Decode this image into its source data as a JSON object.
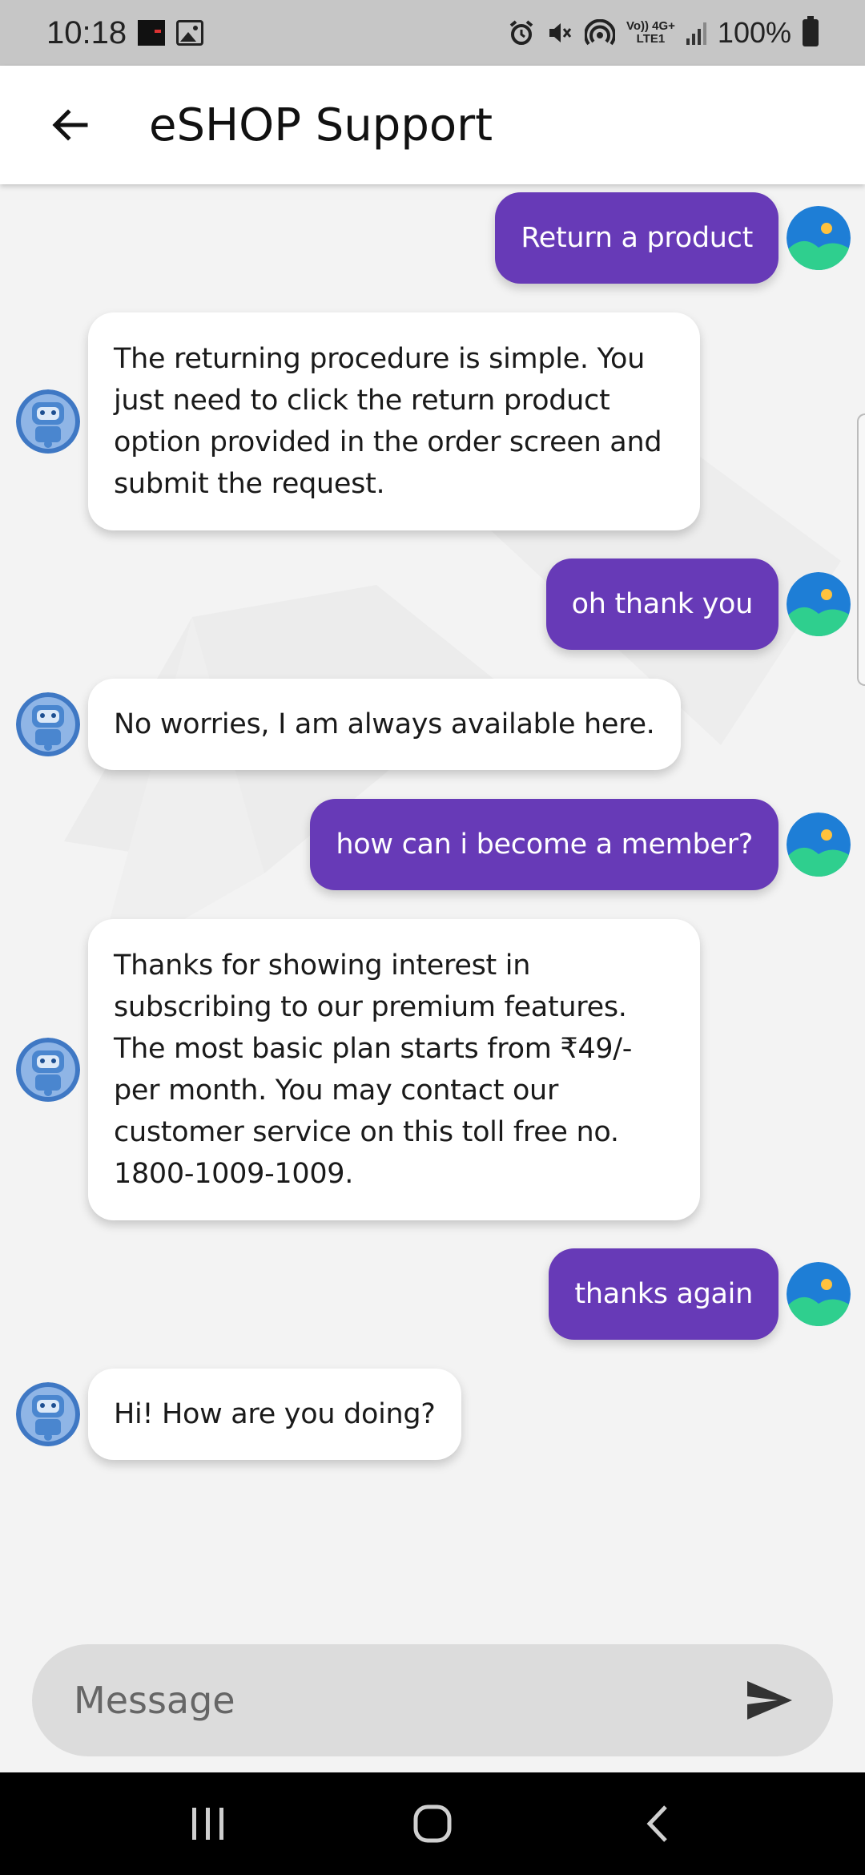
{
  "status_bar": {
    "time": "10:18",
    "network_label": "Vo)) 4G+\nLTE1",
    "battery": "100%",
    "icons": [
      "app-notification-icon",
      "gallery-icon",
      "alarm-icon",
      "mute-icon",
      "hotspot-icon",
      "signal-icon",
      "battery-icon"
    ]
  },
  "app_bar": {
    "title": "eSHOP Support",
    "back_icon": "arrow-left-icon"
  },
  "messages": [
    {
      "sender": "user",
      "text": "Return a product"
    },
    {
      "sender": "bot",
      "text": "The returning procedure is simple. You just need to click the return product option provided in the order screen and submit the request."
    },
    {
      "sender": "user",
      "text": "oh thank you"
    },
    {
      "sender": "bot",
      "text": "No worries, I am always available here."
    },
    {
      "sender": "user",
      "text": "how can i become a member?"
    },
    {
      "sender": "bot",
      "text": "Thanks for showing interest in subscribing to our premium features. The most basic plan starts from ₹49/- per month. You may contact our customer service on this toll free no. 1800-1009-1009."
    },
    {
      "sender": "user",
      "text": "thanks again"
    },
    {
      "sender": "bot",
      "text": "Hi! How are you doing?"
    }
  ],
  "input": {
    "placeholder": "Message",
    "value": "",
    "send_icon": "send-icon"
  },
  "nav_bar": {
    "icons": [
      "recent-apps-icon",
      "home-icon",
      "back-icon"
    ]
  },
  "colors": {
    "accent": "#673ab7",
    "bot_bubble": "#ffffff",
    "chat_background": "#f3f3f3",
    "input_background": "#dcdcdc"
  }
}
